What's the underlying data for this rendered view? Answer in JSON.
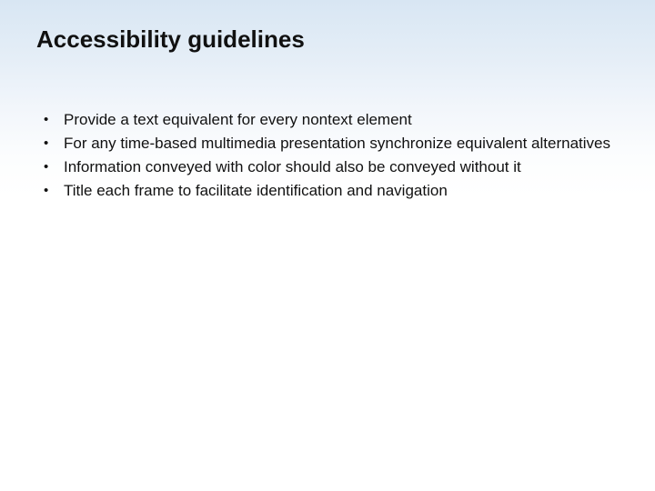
{
  "slide": {
    "title": "Accessibility guidelines",
    "bullets": [
      "Provide a text equivalent for every nontext element",
      "For any time-based multimedia presentation synchronize equivalent alternatives",
      "Information conveyed with color should also be conveyed without it",
      "Title each frame to facilitate identification and navigation"
    ]
  }
}
